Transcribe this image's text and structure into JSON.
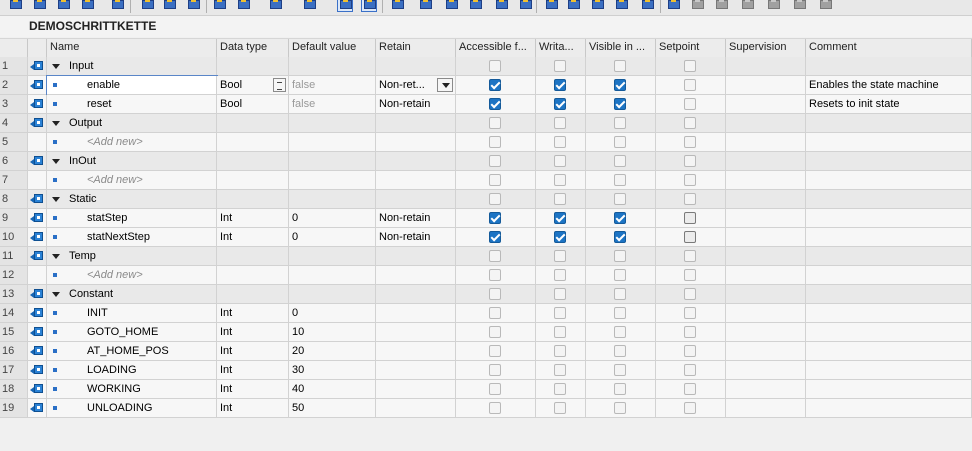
{
  "block": {
    "title": "DEMOSCHRITTKETTE"
  },
  "toolbar": {
    "icons": [
      "insert-row-icon",
      "add-row-icon",
      "expand-all-icon",
      "collapse-all-icon",
      "show-hmi-icon",
      "align-left-icon",
      "reset-values-icon",
      "indent-icon",
      "comment-icon",
      "block-dropdown-icon",
      "block-type-dropdown-icon",
      "block-view-dropdown-icon",
      "view-detail-icon",
      "view-selected-icon",
      "monitor-all-icon",
      "compile-icon",
      "breakpoint-icon",
      "refresh-icon",
      "check-icon",
      "snapshot-icon",
      "load-start-icon",
      "split-icon",
      "indent-right-icon",
      "indent-left-icon",
      "outdent-icon",
      "jump-icon",
      "up-icon",
      "down-icon",
      "bookmark-icon",
      "prev-icon",
      "next-icon",
      "network-icon",
      "library-icon",
      "lock-icon"
    ]
  },
  "columns": {
    "name": "Name",
    "data_type": "Data type",
    "default_value": "Default value",
    "retain": "Retain",
    "accessible": "Accessible f...",
    "writable": "Writa...",
    "visible": "Visible in ...",
    "setpoint": "Setpoint",
    "supervision": "Supervision",
    "comment": "Comment"
  },
  "rows": [
    {
      "num": "1",
      "kind": "group",
      "name": "Input",
      "type": "",
      "default": "",
      "retain": "",
      "acc": false,
      "wr": false,
      "vis": false,
      "sp": false,
      "comment": ""
    },
    {
      "num": "2",
      "kind": "member",
      "name": "enable",
      "type": "Bool",
      "default": "false",
      "retain": "Non-ret...",
      "acc": true,
      "wr": true,
      "vis": true,
      "sp": false,
      "comment": "Enables the state machine"
    },
    {
      "num": "3",
      "kind": "member",
      "name": "reset",
      "type": "Bool",
      "default": "false",
      "retain": "Non-retain",
      "acc": true,
      "wr": true,
      "vis": true,
      "sp": false,
      "comment": "Resets to init state"
    },
    {
      "num": "4",
      "kind": "group",
      "name": "Output",
      "type": "",
      "default": "",
      "retain": "",
      "acc": false,
      "wr": false,
      "vis": false,
      "sp": false,
      "comment": ""
    },
    {
      "num": "5",
      "kind": "add",
      "name": "<Add new>",
      "type": "",
      "default": "",
      "retain": "",
      "acc": false,
      "wr": false,
      "vis": false,
      "sp": false,
      "comment": ""
    },
    {
      "num": "6",
      "kind": "group",
      "name": "InOut",
      "type": "",
      "default": "",
      "retain": "",
      "acc": false,
      "wr": false,
      "vis": false,
      "sp": false,
      "comment": ""
    },
    {
      "num": "7",
      "kind": "add",
      "name": "<Add new>",
      "type": "",
      "default": "",
      "retain": "",
      "acc": false,
      "wr": false,
      "vis": false,
      "sp": false,
      "comment": ""
    },
    {
      "num": "8",
      "kind": "group",
      "name": "Static",
      "type": "",
      "default": "",
      "retain": "",
      "acc": false,
      "wr": false,
      "vis": false,
      "sp": false,
      "comment": ""
    },
    {
      "num": "9",
      "kind": "member",
      "name": "statStep",
      "type": "Int",
      "default": "0",
      "retain": "Non-retain",
      "acc": true,
      "wr": true,
      "vis": true,
      "sp": "dark",
      "comment": ""
    },
    {
      "num": "10",
      "kind": "member",
      "name": "statNextStep",
      "type": "Int",
      "default": "0",
      "retain": "Non-retain",
      "acc": true,
      "wr": true,
      "vis": true,
      "sp": "dark",
      "comment": ""
    },
    {
      "num": "11",
      "kind": "group",
      "name": "Temp",
      "type": "",
      "default": "",
      "retain": "",
      "acc": false,
      "wr": false,
      "vis": false,
      "sp": false,
      "comment": ""
    },
    {
      "num": "12",
      "kind": "add",
      "name": "<Add new>",
      "type": "",
      "default": "",
      "retain": "",
      "acc": false,
      "wr": false,
      "vis": false,
      "sp": false,
      "comment": ""
    },
    {
      "num": "13",
      "kind": "group",
      "name": "Constant",
      "type": "",
      "default": "",
      "retain": "",
      "acc": false,
      "wr": false,
      "vis": false,
      "sp": false,
      "comment": ""
    },
    {
      "num": "14",
      "kind": "member",
      "name": "INIT",
      "type": "Int",
      "default": "0",
      "retain": "",
      "acc": false,
      "wr": false,
      "vis": false,
      "sp": false,
      "comment": ""
    },
    {
      "num": "15",
      "kind": "member",
      "name": "GOTO_HOME",
      "type": "Int",
      "default": "10",
      "retain": "",
      "acc": false,
      "wr": false,
      "vis": false,
      "sp": false,
      "comment": ""
    },
    {
      "num": "16",
      "kind": "member",
      "name": "AT_HOME_POS",
      "type": "Int",
      "default": "20",
      "retain": "",
      "acc": false,
      "wr": false,
      "vis": false,
      "sp": false,
      "comment": ""
    },
    {
      "num": "17",
      "kind": "member",
      "name": "LOADING",
      "type": "Int",
      "default": "30",
      "retain": "",
      "acc": false,
      "wr": false,
      "vis": false,
      "sp": false,
      "comment": ""
    },
    {
      "num": "18",
      "kind": "member",
      "name": "WORKING",
      "type": "Int",
      "default": "40",
      "retain": "",
      "acc": false,
      "wr": false,
      "vis": false,
      "sp": false,
      "comment": ""
    },
    {
      "num": "19",
      "kind": "member",
      "name": "UNLOADING",
      "type": "Int",
      "default": "50",
      "retain": "",
      "acc": false,
      "wr": false,
      "vis": false,
      "sp": false,
      "comment": ""
    }
  ]
}
